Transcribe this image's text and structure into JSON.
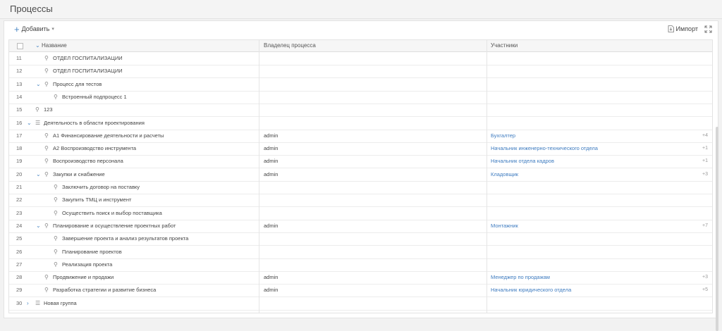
{
  "page": {
    "title": "Процессы"
  },
  "toolbar": {
    "add_label": "Добавить",
    "import_label": "Импорт"
  },
  "columns": {
    "name": "Название",
    "owner": "Владелец процесса",
    "participants": "Участники"
  },
  "rows": [
    {
      "num": "11",
      "name": "ОТДЕЛ ГОСПИТАЛИЗАЦИИ",
      "level": 2,
      "caret": "",
      "icon": "process-icon",
      "owner": "",
      "participant": "",
      "extra": ""
    },
    {
      "num": "12",
      "name": "ОТДЕЛ ГОСПИТАЛИЗАЦИИ",
      "level": 2,
      "caret": "",
      "icon": "process-icon",
      "owner": "",
      "participant": "",
      "extra": ""
    },
    {
      "num": "13",
      "name": "Процесс для тестов",
      "level": 2,
      "caret": "down",
      "icon": "process-icon",
      "owner": "",
      "participant": "",
      "extra": ""
    },
    {
      "num": "14",
      "name": "Встроенный подпроцесс 1",
      "level": 3,
      "caret": "",
      "icon": "process-icon",
      "owner": "",
      "participant": "",
      "extra": ""
    },
    {
      "num": "15",
      "name": "123",
      "level": 1,
      "caret": "",
      "icon": "process-icon",
      "owner": "",
      "participant": "",
      "extra": ""
    },
    {
      "num": "16",
      "name": "Деятельность в области проектирования",
      "level": 1,
      "caret": "down",
      "icon": "group-icon",
      "owner": "",
      "participant": "",
      "extra": ""
    },
    {
      "num": "17",
      "name": "А1 Финансирование деятельности и расчеты",
      "level": 2,
      "caret": "",
      "icon": "process-icon",
      "owner": "admin",
      "participant": "Бухгалтер",
      "extra": "+4"
    },
    {
      "num": "18",
      "name": "А2 Воспроизводство инструмента",
      "level": 2,
      "caret": "",
      "icon": "process-icon",
      "owner": "admin",
      "participant": "Начальник инженерно-технического отдела",
      "extra": "+1"
    },
    {
      "num": "19",
      "name": "Воспроизводство персонала",
      "level": 2,
      "caret": "",
      "icon": "process-icon",
      "owner": "admin",
      "participant": "Начальник отдела кадров",
      "extra": "+1"
    },
    {
      "num": "20",
      "name": "Закупки и снабжение",
      "level": 2,
      "caret": "down",
      "icon": "process-icon",
      "owner": "admin",
      "participant": "Кладовщик",
      "extra": "+3"
    },
    {
      "num": "21",
      "name": "Заключить договор на поставку",
      "level": 3,
      "caret": "",
      "icon": "process-icon",
      "owner": "",
      "participant": "",
      "extra": ""
    },
    {
      "num": "22",
      "name": "Закупить ТМЦ и инструмент",
      "level": 3,
      "caret": "",
      "icon": "process-icon",
      "owner": "",
      "participant": "",
      "extra": ""
    },
    {
      "num": "23",
      "name": "Осуществить поиск и выбор поставщика",
      "level": 3,
      "caret": "",
      "icon": "process-icon",
      "owner": "",
      "participant": "",
      "extra": ""
    },
    {
      "num": "24",
      "name": "Планирование и осуществление проектных работ",
      "level": 2,
      "caret": "down",
      "icon": "process-icon",
      "owner": "admin",
      "participant": "Монтажник",
      "extra": "+7"
    },
    {
      "num": "25",
      "name": "Завершение проекта и анализ результатов проекта",
      "level": 3,
      "caret": "",
      "icon": "process-icon",
      "owner": "",
      "participant": "",
      "extra": ""
    },
    {
      "num": "26",
      "name": "Планирование проектов",
      "level": 3,
      "caret": "",
      "icon": "process-icon",
      "owner": "",
      "participant": "",
      "extra": ""
    },
    {
      "num": "27",
      "name": "Реализация проекта",
      "level": 3,
      "caret": "",
      "icon": "process-icon",
      "owner": "",
      "participant": "",
      "extra": ""
    },
    {
      "num": "28",
      "name": "Продвижение и продажи",
      "level": 2,
      "caret": "",
      "icon": "process-icon",
      "owner": "admin",
      "participant": "Менеджер по продажам",
      "extra": "+3"
    },
    {
      "num": "29",
      "name": "Разработка стратегии и развитие бизнеса",
      "level": 2,
      "caret": "",
      "icon": "process-icon",
      "owner": "admin",
      "participant": "Начальник юридического отдела",
      "extra": "+5"
    },
    {
      "num": "30",
      "name": "Новая группа",
      "level": 1,
      "caret": "right",
      "icon": "group-icon",
      "owner": "",
      "participant": "",
      "extra": ""
    }
  ]
}
